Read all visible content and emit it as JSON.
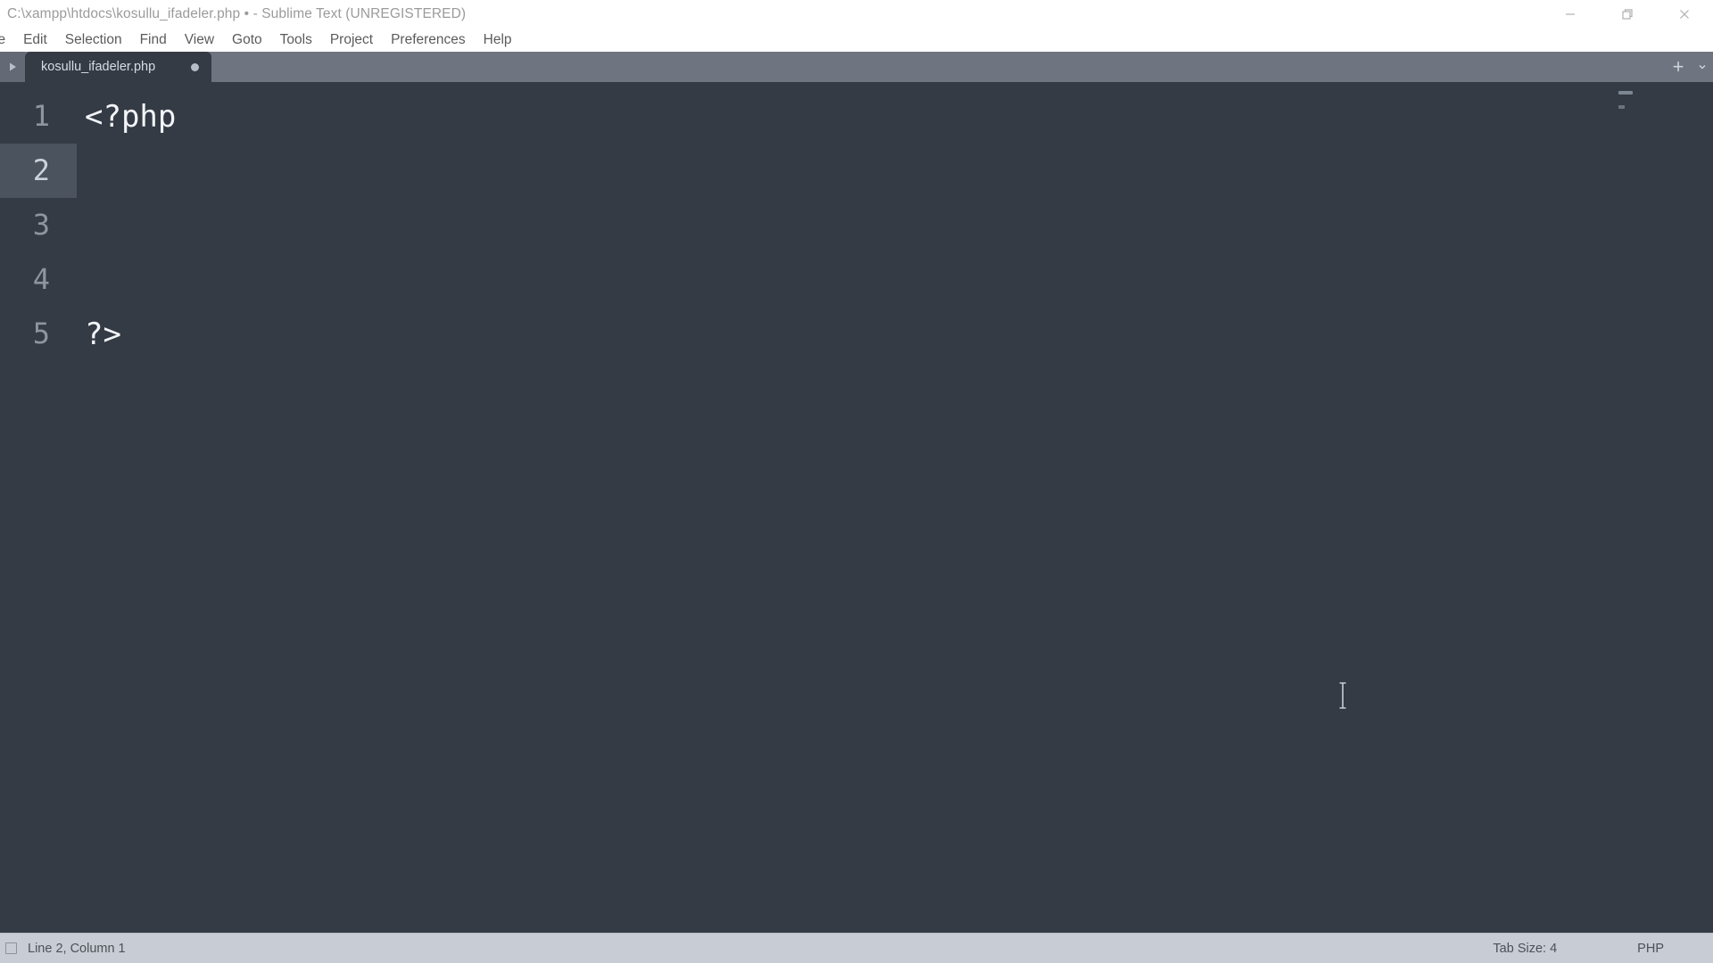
{
  "window": {
    "title": "C:\\xampp\\htdocs\\kosullu_ifadeler.php • - Sublime Text (UNREGISTERED)",
    "controls": {
      "minimize": "minimize-icon",
      "restore": "restore-icon",
      "close": "close-icon"
    }
  },
  "menubar": {
    "items": [
      {
        "label": "le"
      },
      {
        "label": "Edit"
      },
      {
        "label": "Selection"
      },
      {
        "label": "Find"
      },
      {
        "label": "View"
      },
      {
        "label": "Goto"
      },
      {
        "label": "Tools"
      },
      {
        "label": "Project"
      },
      {
        "label": "Preferences"
      },
      {
        "label": "Help"
      }
    ]
  },
  "tabbar": {
    "sidebar_toggle_icon": "play-triangle-icon",
    "tabs": [
      {
        "label": "kosullu_ifadeler.php",
        "dirty": true
      }
    ],
    "new_tab_label": "+",
    "overflow_icon": "chevron-down-icon"
  },
  "editor": {
    "lines": [
      {
        "number": "1",
        "text": "<?php",
        "active": false
      },
      {
        "number": "2",
        "text": "",
        "active": true
      },
      {
        "number": "3",
        "text": "",
        "active": false
      },
      {
        "number": "4",
        "text": "",
        "active": false
      },
      {
        "number": "5",
        "text": "?>",
        "active": false
      }
    ]
  },
  "statusbar": {
    "indicator_icon": "encoding-box-icon",
    "caret_position": "Line 2, Column 1",
    "tab_size": "Tab Size: 4",
    "syntax": "PHP"
  },
  "colors": {
    "editor_bg": "#343b45",
    "tabbar_bg": "#6e7480",
    "active_line_gutter": "#4a535e",
    "statusbar_bg": "#c8ccd4",
    "titlebar_bg": "#ffffff",
    "code_fg": "#f2f4f7",
    "gutter_fg": "#8d959f"
  }
}
